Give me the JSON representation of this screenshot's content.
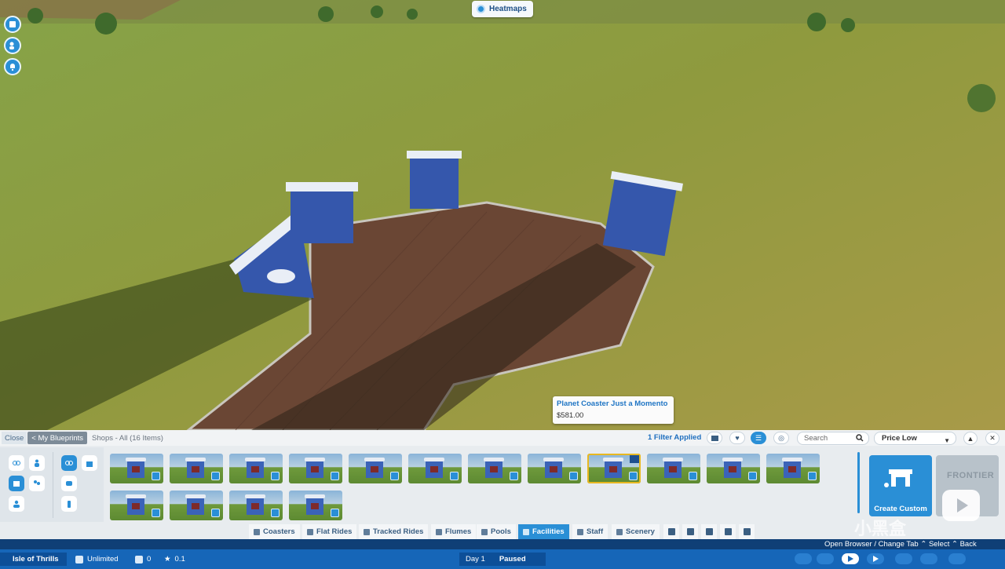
{
  "hud": {
    "heatmaps_label": "Heatmaps"
  },
  "tooltip": {
    "title": "Planet Coaster Just a Momento",
    "price": "$581.00"
  },
  "browser": {
    "close_label": "Close",
    "back_label": "< My Blueprints",
    "breadcrumb": "Shops - All (16 Items)",
    "filter_status": "1 Filter Applied",
    "search_placeholder": "Search",
    "sort_value": "Price Low",
    "items_count": 16,
    "selected_index": 8,
    "create_custom_label": "Create Custom",
    "frontier_logo": "FRONTIER"
  },
  "categories": [
    {
      "label": "Coasters"
    },
    {
      "label": "Flat Rides"
    },
    {
      "label": "Tracked Rides"
    },
    {
      "label": "Flumes"
    },
    {
      "label": "Pools"
    },
    {
      "label": "Facilities"
    },
    {
      "label": "Staff"
    },
    {
      "label": "Scenery"
    }
  ],
  "active_category": "Facilities",
  "hint": {
    "text": "Open Browser / Change Tab  ⌃ Select  ⌃ Back"
  },
  "status": {
    "park_name": "Isle of Thrills",
    "money": "Unlimited",
    "guests": "0",
    "rating": "0.1",
    "day": "Day 1",
    "state": "Paused"
  },
  "watermark": "小黑盒",
  "colors": {
    "accent": "#2a8fd6",
    "status_bar": "#1666b8",
    "selection": "#e8b820"
  }
}
